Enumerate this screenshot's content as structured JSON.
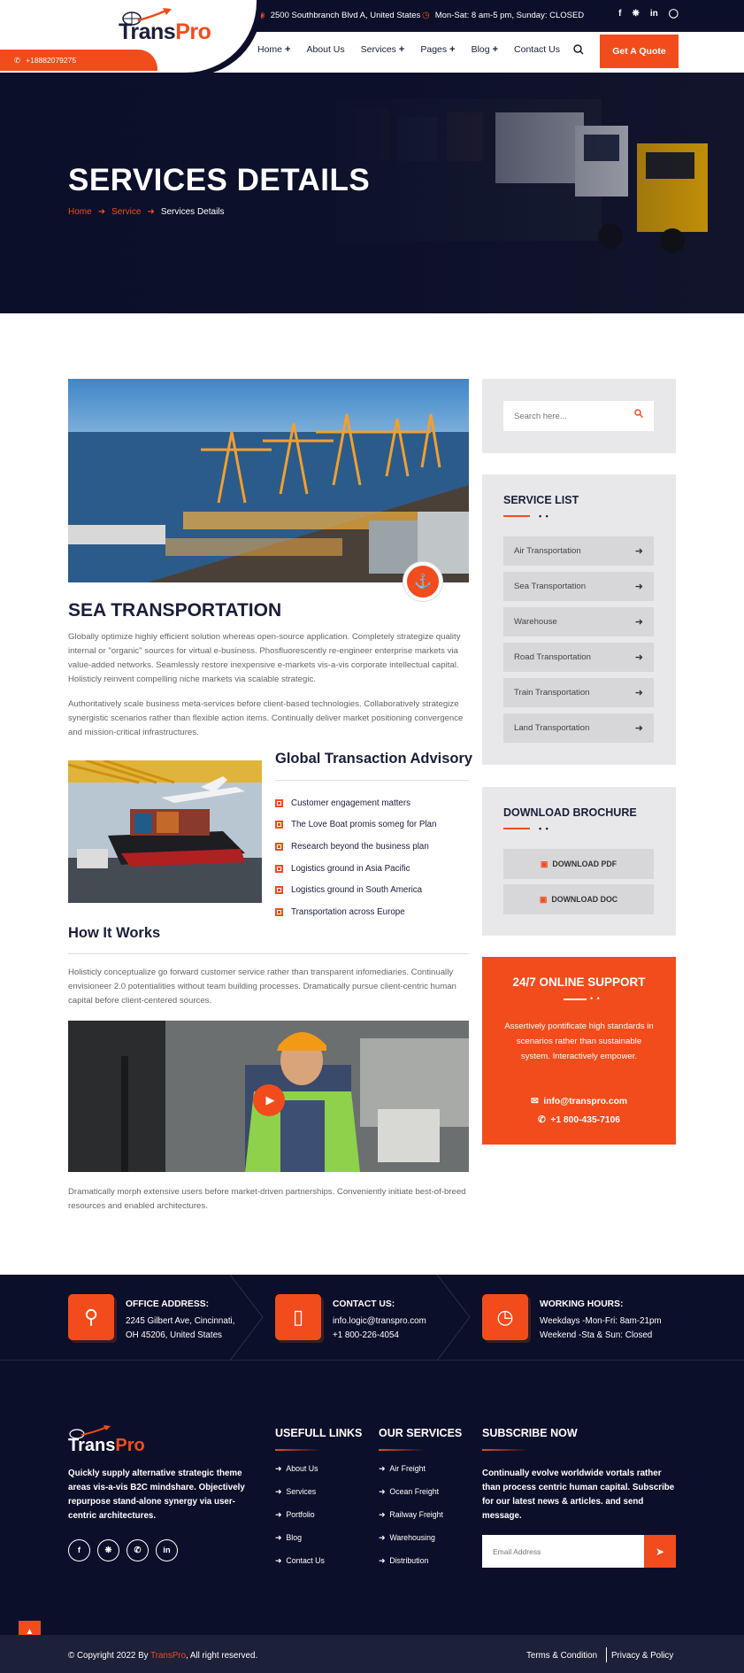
{
  "topbar": {
    "address": "2500 Southbranch Blvd A, United States",
    "hours": "Mon-Sat: 8 am-5 pm, Sunday: CLOSED",
    "social_icons": [
      "facebook-icon",
      "twitter-icon",
      "linkedin-icon",
      "instagram-icon"
    ]
  },
  "header": {
    "phone": "+18882079275",
    "logo_text_1": "Trans",
    "logo_text_2": "Pro",
    "nav": [
      "Home",
      "About Us",
      "Services",
      "Pages",
      "Blog",
      "Contact Us"
    ],
    "quote_button": "Get A Quote"
  },
  "hero": {
    "title": "SERVICES DETAILS",
    "breadcrumb": [
      "Home",
      "Service",
      "Services Details"
    ]
  },
  "main": {
    "title": "SEA TRANSPORTATION",
    "para1": "Globally optimize highly efficient solution whereas open-source application. Completely strategize quality internal or \"organic\" sources for virtual e-business. Phosfluorescently re-engineer enterprise markets via value-added networks. Seamlessly restore inexpensive e-markets vis-a-vis corporate intellectual capital. Holisticly reinvent compelling niche markets via scalable strategic.",
    "para2": "Authoritatively scale business meta-services before client-based technologies. Collaboratively strategize synergistic scenarios rather than flexible action items. Continually deliver market positioning convergence and mission-critical infrastructures.",
    "advisory_title": "Global Transaction Advisory",
    "advisory_items": [
      "Customer engagement matters",
      "The Love Boat promis someg for Plan",
      "Research beyond the business plan",
      "Logistics ground in Asia Pacific",
      "Logistics ground in South America",
      "Transportation across Europe"
    ],
    "how_title": "How It Works",
    "how_para": "Holisticly conceptualize go forward customer service rather than transparent infomediaries. Continually envisioneer 2.0 potentialities without team building processes. Dramatically pursue client-centric human capital before client-centered sources.",
    "final_para": "Dramatically morph extensive users before market-driven partnerships. Conveniently initiate best-of-breed resources and enabled architectures."
  },
  "sidebar": {
    "search_placeholder": "Search here...",
    "service_list_title": "SERVICE LIST",
    "dots": "• •",
    "services": [
      "Air Transportation",
      "Sea Transportation",
      "Warehouse",
      "Road Transportation",
      "Train Transportation",
      "Land Transportation"
    ],
    "brochure_title": "DOWNLOAD BROCHURE",
    "download_pdf": "DOWNLOAD PDF",
    "download_doc": "DOWNLOAD DOC",
    "support_title": "24/7 ONLINE SUPPORT",
    "support_text": "Assertively pontificate high standards in scenarios rather than sustainable system. Interactively empower.",
    "support_email": "info@transpro.com",
    "support_phone": "+1 800-435-7106"
  },
  "contact_strip": {
    "office_title": "OFFICE ADDRESS:",
    "office_line1": "2245 Gilbert Ave, Cincinnati,",
    "office_line2": "OH 45206, United States",
    "contact_title": "CONTACT US:",
    "contact_email": "info.logic@transpro.com",
    "contact_phone": "+1 800-226-4054",
    "hours_title": "WORKING HOURS:",
    "hours_line1": "Weekdays -Mon-Fri: 8am-21pm",
    "hours_line2": "Weekend -Sta & Sun: Closed"
  },
  "footer": {
    "logo_text_1": "Trans",
    "logo_text_2": "Pro",
    "about": "Quickly supply alternative strategic theme areas vis-a-vis B2C mindshare. Objectively repurpose stand-alone synergy via user-centric architectures.",
    "social_icons": [
      "facebook-icon",
      "twitter-icon",
      "whatsapp-icon",
      "linkedin-icon"
    ],
    "links_title": "USEFULL LINKS",
    "links": [
      "About Us",
      "Services",
      "Portfolio",
      "Blog",
      "Contact Us"
    ],
    "services_title": "OUR SERVICES",
    "services": [
      "Air Freight",
      "Ocean Freight",
      "Railway Freight",
      "Warehousing",
      "Distribution"
    ],
    "subscribe_title": "SUBSCRIBE NOW",
    "subscribe_text": "Continually evolve worldwide vortals rather than process centric human capital. Subscribe for our latest news & articles. and send message.",
    "email_placeholder": "Email Address",
    "copyright_1": "© Copyright 2022 By ",
    "copyright_brand": "TransPro",
    "copyright_2": ", All right reserved.",
    "terms": "Terms & Condition",
    "policy": "Privacy & Policy"
  },
  "colors": {
    "accent": "#f24c1c",
    "dark": "#0c0f2a",
    "sidebar_bg": "#e8e8ea"
  }
}
